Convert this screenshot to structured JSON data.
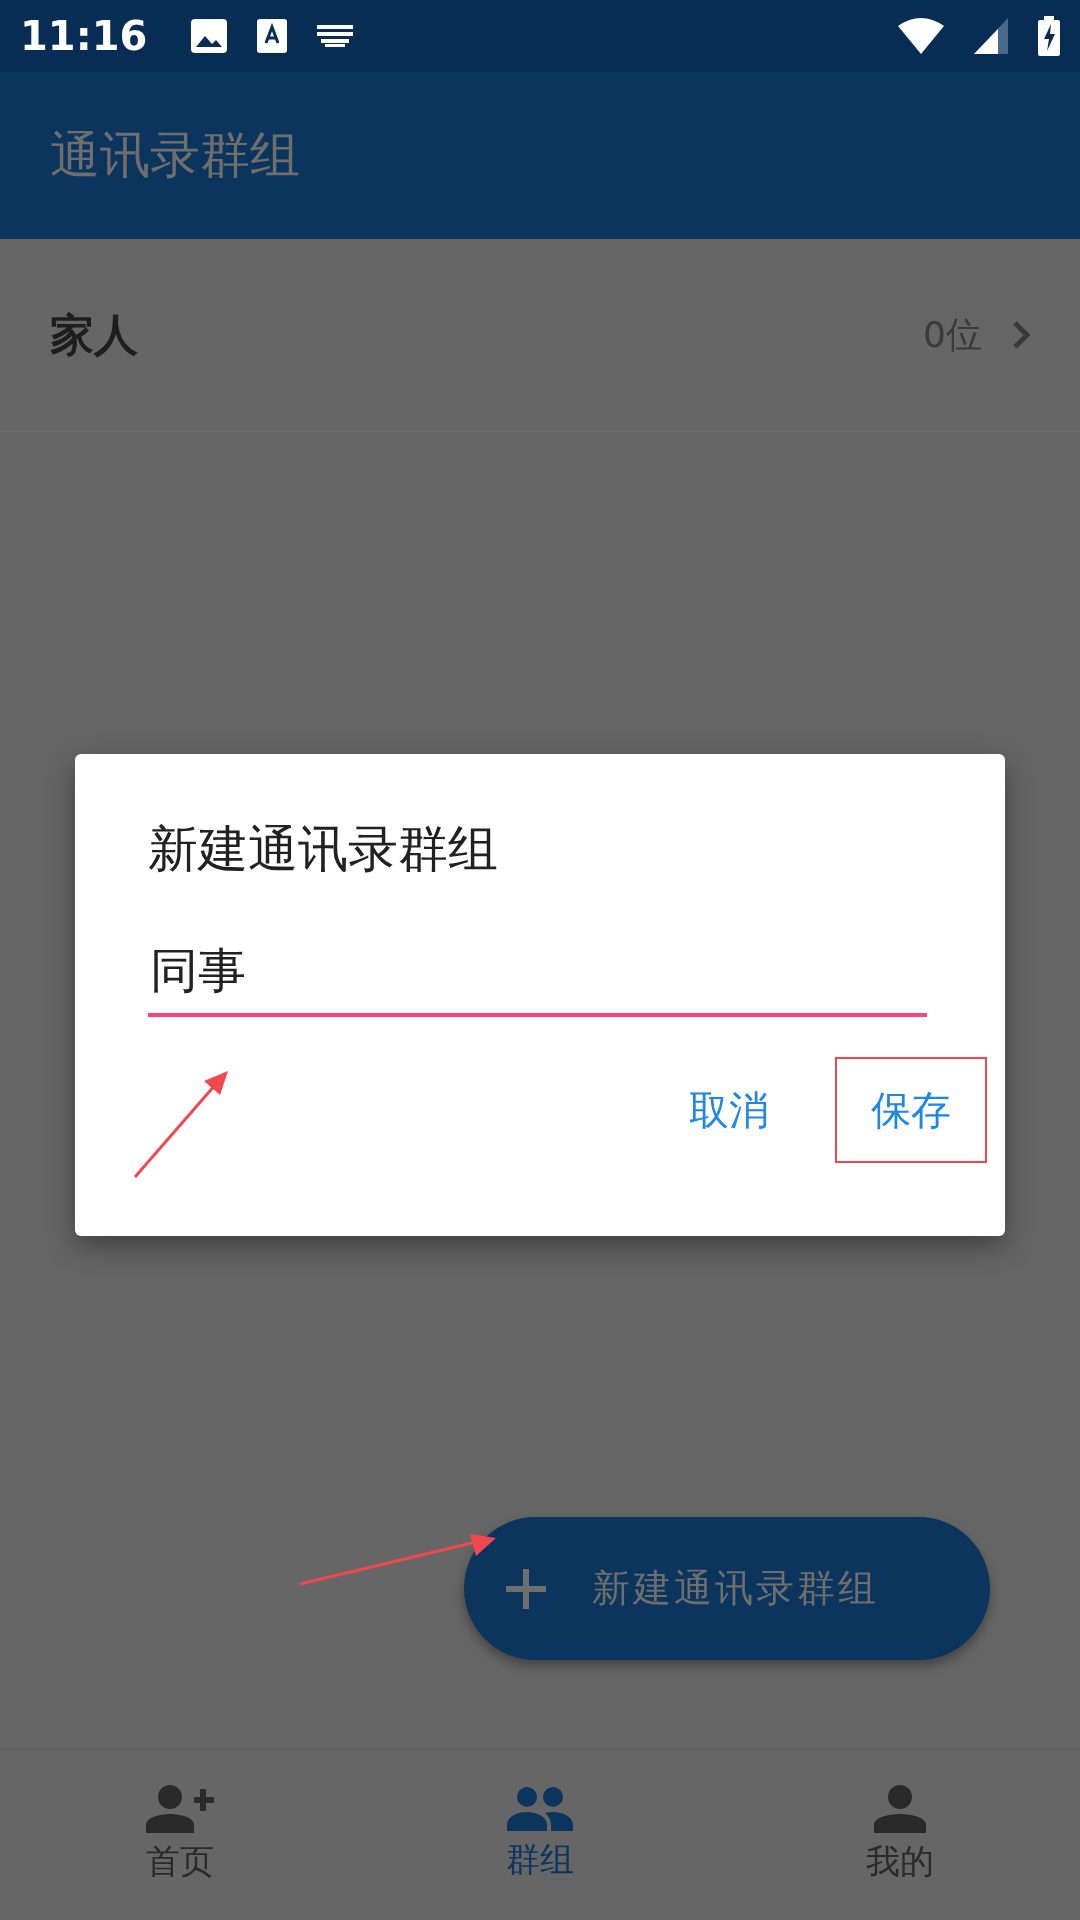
{
  "status_bar": {
    "time": "11:16"
  },
  "app_bar": {
    "title": "通讯录群组"
  },
  "groups": [
    {
      "name": "家人",
      "count": "0位"
    }
  ],
  "fab": {
    "label": "新建通讯录群组"
  },
  "bottom_nav": [
    {
      "label": "首页",
      "kind": "add-person",
      "selected": false
    },
    {
      "label": "群组",
      "kind": "people",
      "selected": true
    },
    {
      "label": "我的",
      "kind": "person",
      "selected": false
    }
  ],
  "dialog": {
    "title": "新建通讯录群组",
    "input": {
      "value": "同事"
    },
    "buttons": [
      {
        "label": "取消",
        "highlighted": false
      },
      {
        "label": "保存",
        "highlighted": true
      }
    ]
  }
}
